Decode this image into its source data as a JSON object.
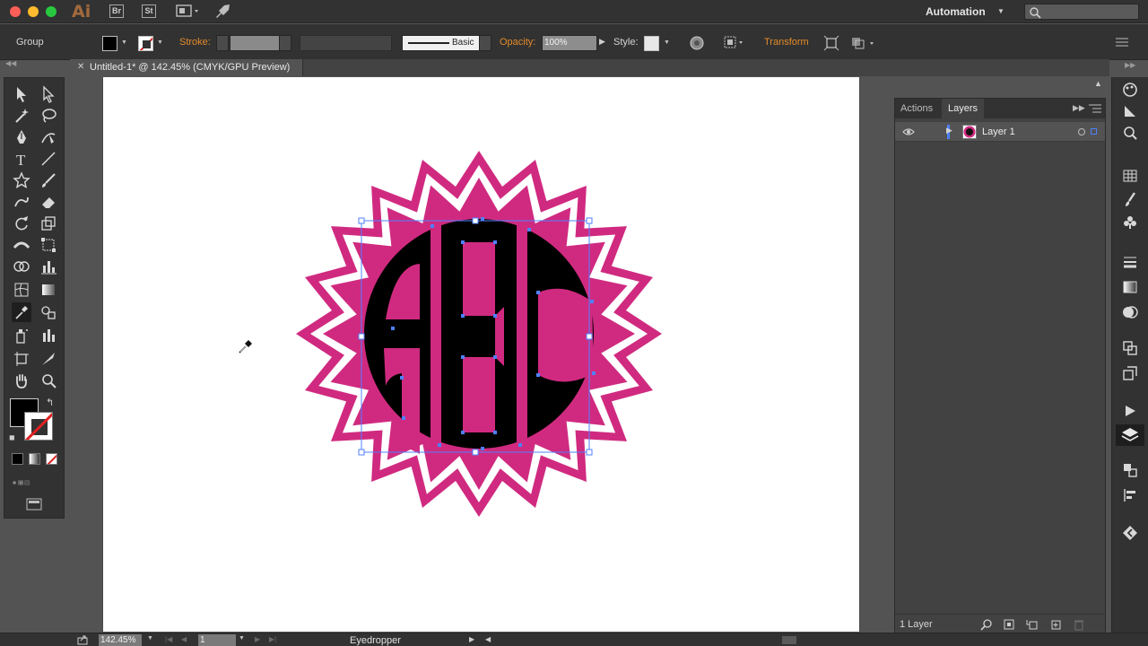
{
  "app": {
    "logo": "Ai",
    "bridge_label": "Br",
    "stock_label": "St",
    "workspace": "Automation"
  },
  "controlbar": {
    "selection_type": "Group",
    "stroke_label": "Stroke:",
    "brush_label": "Basic",
    "opacity_label": "Opacity:",
    "opacity_value": "100%",
    "style_label": "Style:",
    "transform_label": "Transform"
  },
  "document": {
    "tab_title": "Untitled-1* @ 142.45% (CMYK/GPU Preview)"
  },
  "artwork": {
    "monogram": "ABC",
    "colors": {
      "pink": "#d02a80",
      "black": "#000000",
      "white": "#ffffff",
      "selection": "#4f80ff"
    }
  },
  "layers_panel": {
    "tabs": [
      "Actions",
      "Layers"
    ],
    "active_tab": "Layers",
    "layers": [
      {
        "name": "Layer 1",
        "color": "#4f80ff"
      }
    ],
    "footer_count": "1 Layer"
  },
  "statusbar": {
    "zoom": "142.45%",
    "artboard_number": "1",
    "current_tool": "Eyedropper"
  },
  "colors": {
    "accent_orange": "#e38b29",
    "panel_dark": "#323232",
    "panel_mid": "#424242",
    "canvas_bg": "#535353"
  }
}
